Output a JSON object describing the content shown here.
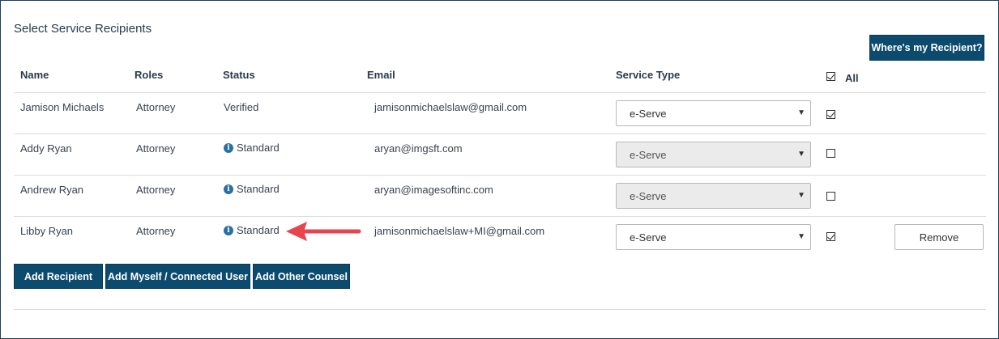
{
  "section_title": "Select Service Recipients",
  "where_button": "Where's my Recipient?",
  "headers": {
    "name": "Name",
    "roles": "Roles",
    "status": "Status",
    "email": "Email",
    "service_type": "Service Type",
    "all": "All"
  },
  "rows": [
    {
      "name": "Jamison Michaels",
      "role": "Attorney",
      "status": "Verified",
      "email": "jamisonmichaelslaw@gmail.com",
      "service": "e-Serve",
      "checked": true
    },
    {
      "name": "Addy Ryan",
      "role": "Attorney",
      "status": "Standard",
      "email": "aryan@imgsft.com",
      "service": "e-Serve",
      "checked": false
    },
    {
      "name": "Andrew Ryan",
      "role": "Attorney",
      "status": "Standard",
      "email": "aryan@imagesoftinc.com",
      "service": "e-Serve",
      "checked": false
    },
    {
      "name": "Libby Ryan",
      "role": "Attorney",
      "status": "Standard",
      "email": "jamisonmichaelslaw+MI@gmail.com",
      "service": "e-Serve",
      "checked": true
    }
  ],
  "remove_button": "Remove",
  "actions": {
    "add_recipient": "Add Recipient",
    "add_myself": "Add Myself / Connected User",
    "add_other_counsel": "Add Other Counsel"
  },
  "colors": {
    "button_bg": "#0c4a6e",
    "arrow": "#e8434f",
    "info_icon": "#2a6fa8"
  },
  "icons": {
    "info": "info-circle-icon",
    "annotation": "red-arrow-icon"
  }
}
